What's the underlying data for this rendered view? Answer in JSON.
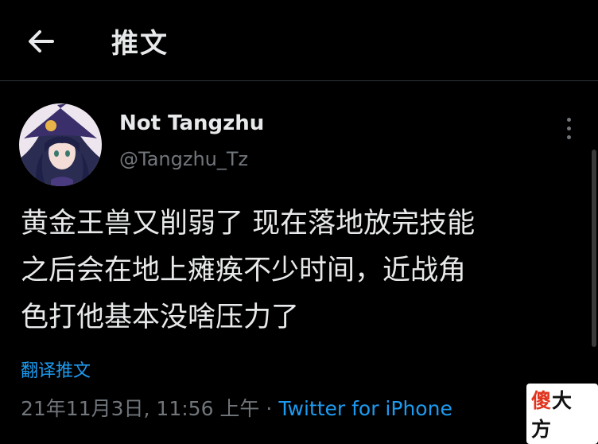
{
  "header": {
    "title": "推文",
    "back_icon": "arrow-left-icon"
  },
  "tweet": {
    "author": {
      "display_name": "Not Tangzhu",
      "handle": "@Tangzhu_Tz",
      "avatar_icon": "anime-witch-avatar"
    },
    "more_icon": "vertical-dots-icon",
    "text_lines": [
      "黄金王兽又削弱了 现在落地放完技能",
      "之后会在地上瘫痪不少时间，近战角",
      "色打他基本没啥压力了"
    ],
    "translate_label": "翻译推文",
    "timestamp": "21年11月3日, 11:56 上午",
    "separator": "·",
    "source": "Twitter for iPhone"
  },
  "watermark": {
    "char1": "傻",
    "rest": "大方"
  },
  "colors": {
    "background": "#000000",
    "text": "#e7e9ea",
    "muted": "#71767b",
    "link": "#1d9bf0"
  }
}
